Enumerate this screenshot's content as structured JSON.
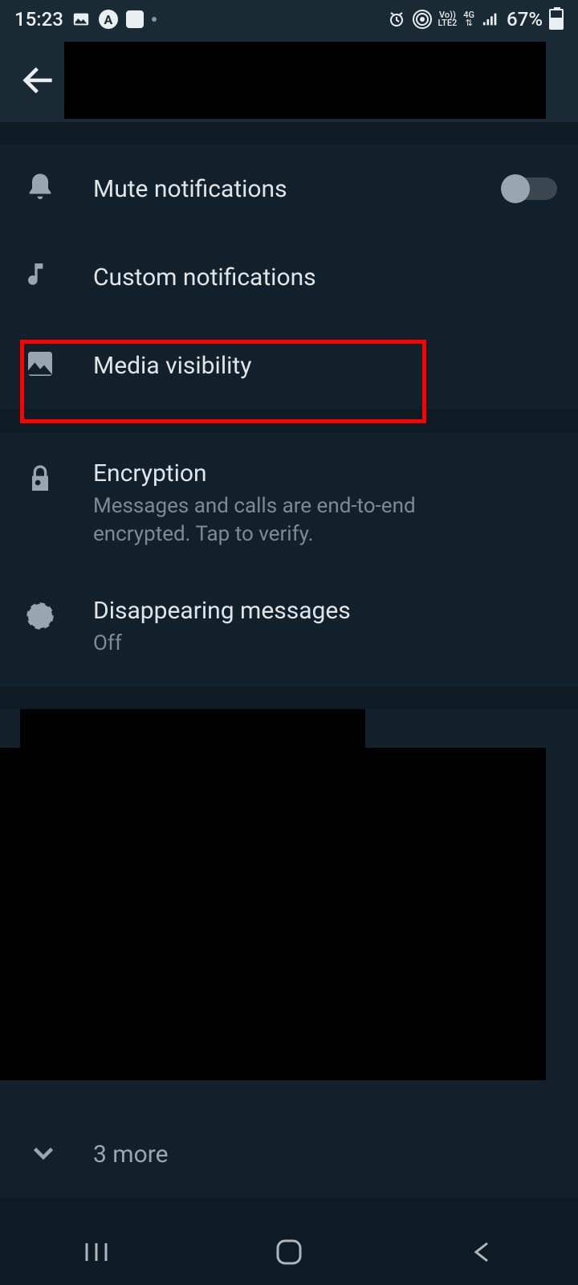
{
  "status": {
    "time": "15:23",
    "battery": "67%",
    "net_top": "Vo))",
    "net_bottom": "LTE2",
    "net2_top": "4G",
    "icon1": "image-icon",
    "icon2": "A",
    "icon3": "app"
  },
  "settings": {
    "mute": "Mute notifications",
    "custom": "Custom notifications",
    "media": "Media visibility",
    "encryption_title": "Encryption",
    "encryption_sub": "Messages and calls are end-to-end encrypted. Tap to verify.",
    "disappearing_title": "Disappearing messages",
    "disappearing_sub": "Off"
  },
  "more": {
    "label": "3 more"
  }
}
